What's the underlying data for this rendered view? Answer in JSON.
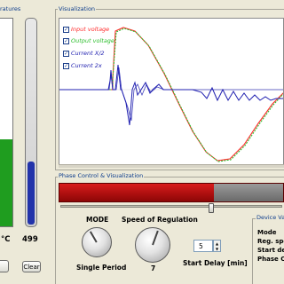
{
  "left_panel": {
    "title": "ratures",
    "temp_green": {
      "label": "°C",
      "fill_fraction": 0.42,
      "color": "#1f9d1f"
    },
    "temp_blue": {
      "label": "499",
      "fill_fraction": 0.31,
      "color": "#2233aa"
    },
    "clear_button": "Clear"
  },
  "visualization": {
    "title": "Visualization",
    "legend": [
      {
        "label": "Input voltage",
        "checked": true,
        "color": "#ff2b2b"
      },
      {
        "label": "Output voltage",
        "checked": true,
        "color": "#2fbf2f"
      },
      {
        "label": "Current X/2",
        "checked": true,
        "color": "#2020b0"
      },
      {
        "label": "Current 2x",
        "checked": true,
        "color": "#2020b0"
      }
    ]
  },
  "phase": {
    "title": "Phase Control & Visualization",
    "bar_fill_fraction": 0.69,
    "slider_value_fraction": 0.68,
    "mode_label": "MODE",
    "mode_value": "Single Period",
    "speed_label": "Speed of Regulation",
    "speed_value": "7",
    "start_delay_value": "5",
    "start_delay_label": "Start Delay [min]"
  },
  "device_values": {
    "title": "Device Valu",
    "rows": [
      "Mode",
      "Reg. spe",
      "Start del",
      "Phase Ct"
    ]
  }
}
